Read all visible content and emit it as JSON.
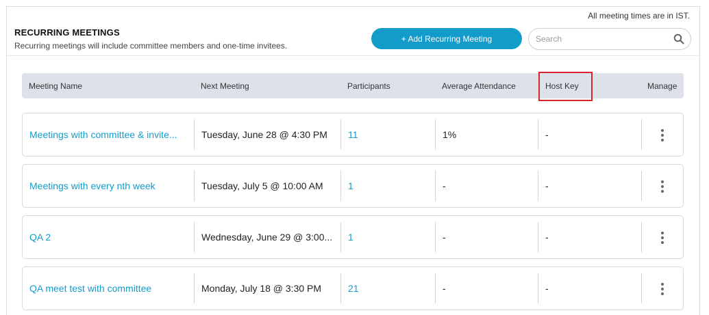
{
  "header": {
    "timezone_note": "All meeting times are in IST.",
    "title": "RECURRING MEETINGS",
    "subtitle": "Recurring meetings will include committee members and one-time invitees.",
    "add_button_label": "+ Add Recurring Meeting",
    "search_placeholder": "Search",
    "search_value": ""
  },
  "columns": {
    "meeting_name": "Meeting Name",
    "next_meeting": "Next Meeting",
    "participants": "Participants",
    "average_attendance": "Average Attendance",
    "host_key": "Host Key",
    "manage": "Manage"
  },
  "rows": [
    {
      "name": "Meetings with committee & invite...",
      "next_meeting": "Tuesday, June 28 @ 4:30 PM",
      "participants": "11",
      "average_attendance": "1%",
      "host_key": "-"
    },
    {
      "name": "Meetings with every nth week",
      "next_meeting": "Tuesday, July 5 @ 10:00 AM",
      "participants": "1",
      "average_attendance": "-",
      "host_key": "-"
    },
    {
      "name": "QA 2",
      "next_meeting": "Wednesday, June 29 @ 3:00...",
      "participants": "1",
      "average_attendance": "-",
      "host_key": "-"
    },
    {
      "name": "QA meet test with committee",
      "next_meeting": "Monday, July 18 @ 3:30 PM",
      "participants": "21",
      "average_attendance": "-",
      "host_key": "-"
    }
  ],
  "icons": {
    "search": "search-icon",
    "manage": "more-vertical-icon"
  },
  "colors": {
    "accent": "#139cc9",
    "header_bg": "#dde2ea",
    "highlight": "#d9232d"
  }
}
